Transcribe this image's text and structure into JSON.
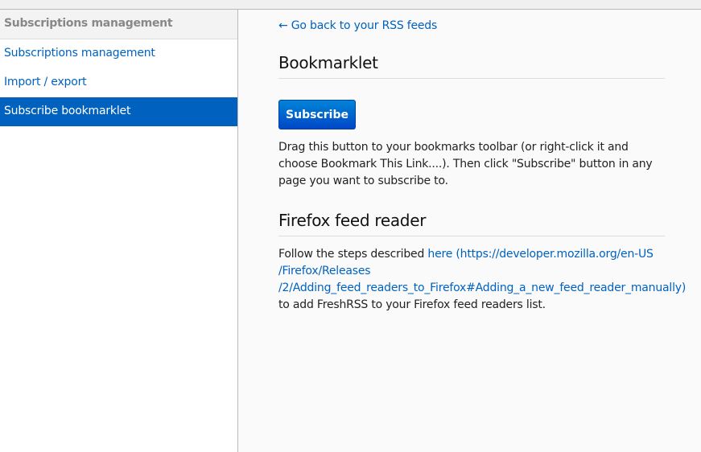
{
  "sidebar": {
    "header": "Subscriptions management",
    "items": [
      {
        "label": "Subscriptions management"
      },
      {
        "label": "Import / export"
      },
      {
        "label": "Subscribe bookmarklet"
      }
    ]
  },
  "main": {
    "back_link": "← Go back to your RSS feeds",
    "bookmarklet": {
      "title": "Bookmarklet",
      "button": "Subscribe",
      "description": "Drag this button to your bookmarks toolbar (or right-click it and choose Bookmark This Link....). Then click \"Subscribe\" button in any page you want to subscribe to."
    },
    "firefox": {
      "title": "Firefox feed reader",
      "text_before": "Follow the steps described ",
      "link_line1": "here (https://developer.mozilla.org/en-US",
      "link_line2": "/Firefox/Releases",
      "link_line3": "/2/Adding_feed_readers_to_Firefox#Adding_a_new_feed_reader_manually)",
      "text_after": "to add FreshRSS to your Firefox feed readers list."
    }
  }
}
